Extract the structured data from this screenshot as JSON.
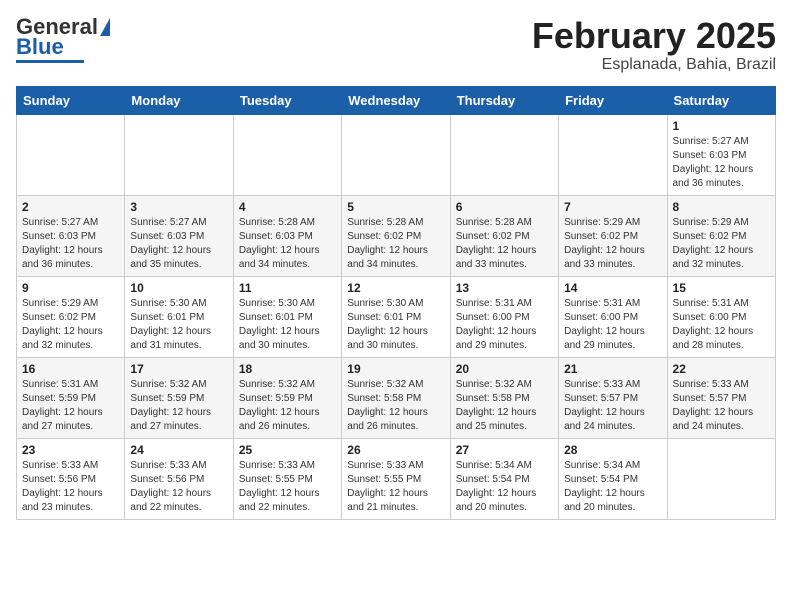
{
  "header": {
    "logo_general": "General",
    "logo_blue": "Blue",
    "title": "February 2025",
    "subtitle": "Esplanada, Bahia, Brazil"
  },
  "weekdays": [
    "Sunday",
    "Monday",
    "Tuesday",
    "Wednesday",
    "Thursday",
    "Friday",
    "Saturday"
  ],
  "weeks": [
    [
      {
        "day": "",
        "info": ""
      },
      {
        "day": "",
        "info": ""
      },
      {
        "day": "",
        "info": ""
      },
      {
        "day": "",
        "info": ""
      },
      {
        "day": "",
        "info": ""
      },
      {
        "day": "",
        "info": ""
      },
      {
        "day": "1",
        "info": "Sunrise: 5:27 AM\nSunset: 6:03 PM\nDaylight: 12 hours\nand 36 minutes."
      }
    ],
    [
      {
        "day": "2",
        "info": "Sunrise: 5:27 AM\nSunset: 6:03 PM\nDaylight: 12 hours\nand 36 minutes."
      },
      {
        "day": "3",
        "info": "Sunrise: 5:27 AM\nSunset: 6:03 PM\nDaylight: 12 hours\nand 35 minutes."
      },
      {
        "day": "4",
        "info": "Sunrise: 5:28 AM\nSunset: 6:03 PM\nDaylight: 12 hours\nand 34 minutes."
      },
      {
        "day": "5",
        "info": "Sunrise: 5:28 AM\nSunset: 6:02 PM\nDaylight: 12 hours\nand 34 minutes."
      },
      {
        "day": "6",
        "info": "Sunrise: 5:28 AM\nSunset: 6:02 PM\nDaylight: 12 hours\nand 33 minutes."
      },
      {
        "day": "7",
        "info": "Sunrise: 5:29 AM\nSunset: 6:02 PM\nDaylight: 12 hours\nand 33 minutes."
      },
      {
        "day": "8",
        "info": "Sunrise: 5:29 AM\nSunset: 6:02 PM\nDaylight: 12 hours\nand 32 minutes."
      }
    ],
    [
      {
        "day": "9",
        "info": "Sunrise: 5:29 AM\nSunset: 6:02 PM\nDaylight: 12 hours\nand 32 minutes."
      },
      {
        "day": "10",
        "info": "Sunrise: 5:30 AM\nSunset: 6:01 PM\nDaylight: 12 hours\nand 31 minutes."
      },
      {
        "day": "11",
        "info": "Sunrise: 5:30 AM\nSunset: 6:01 PM\nDaylight: 12 hours\nand 30 minutes."
      },
      {
        "day": "12",
        "info": "Sunrise: 5:30 AM\nSunset: 6:01 PM\nDaylight: 12 hours\nand 30 minutes."
      },
      {
        "day": "13",
        "info": "Sunrise: 5:31 AM\nSunset: 6:00 PM\nDaylight: 12 hours\nand 29 minutes."
      },
      {
        "day": "14",
        "info": "Sunrise: 5:31 AM\nSunset: 6:00 PM\nDaylight: 12 hours\nand 29 minutes."
      },
      {
        "day": "15",
        "info": "Sunrise: 5:31 AM\nSunset: 6:00 PM\nDaylight: 12 hours\nand 28 minutes."
      }
    ],
    [
      {
        "day": "16",
        "info": "Sunrise: 5:31 AM\nSunset: 5:59 PM\nDaylight: 12 hours\nand 27 minutes."
      },
      {
        "day": "17",
        "info": "Sunrise: 5:32 AM\nSunset: 5:59 PM\nDaylight: 12 hours\nand 27 minutes."
      },
      {
        "day": "18",
        "info": "Sunrise: 5:32 AM\nSunset: 5:59 PM\nDaylight: 12 hours\nand 26 minutes."
      },
      {
        "day": "19",
        "info": "Sunrise: 5:32 AM\nSunset: 5:58 PM\nDaylight: 12 hours\nand 26 minutes."
      },
      {
        "day": "20",
        "info": "Sunrise: 5:32 AM\nSunset: 5:58 PM\nDaylight: 12 hours\nand 25 minutes."
      },
      {
        "day": "21",
        "info": "Sunrise: 5:33 AM\nSunset: 5:57 PM\nDaylight: 12 hours\nand 24 minutes."
      },
      {
        "day": "22",
        "info": "Sunrise: 5:33 AM\nSunset: 5:57 PM\nDaylight: 12 hours\nand 24 minutes."
      }
    ],
    [
      {
        "day": "23",
        "info": "Sunrise: 5:33 AM\nSunset: 5:56 PM\nDaylight: 12 hours\nand 23 minutes."
      },
      {
        "day": "24",
        "info": "Sunrise: 5:33 AM\nSunset: 5:56 PM\nDaylight: 12 hours\nand 22 minutes."
      },
      {
        "day": "25",
        "info": "Sunrise: 5:33 AM\nSunset: 5:55 PM\nDaylight: 12 hours\nand 22 minutes."
      },
      {
        "day": "26",
        "info": "Sunrise: 5:33 AM\nSunset: 5:55 PM\nDaylight: 12 hours\nand 21 minutes."
      },
      {
        "day": "27",
        "info": "Sunrise: 5:34 AM\nSunset: 5:54 PM\nDaylight: 12 hours\nand 20 minutes."
      },
      {
        "day": "28",
        "info": "Sunrise: 5:34 AM\nSunset: 5:54 PM\nDaylight: 12 hours\nand 20 minutes."
      },
      {
        "day": "",
        "info": ""
      }
    ]
  ]
}
